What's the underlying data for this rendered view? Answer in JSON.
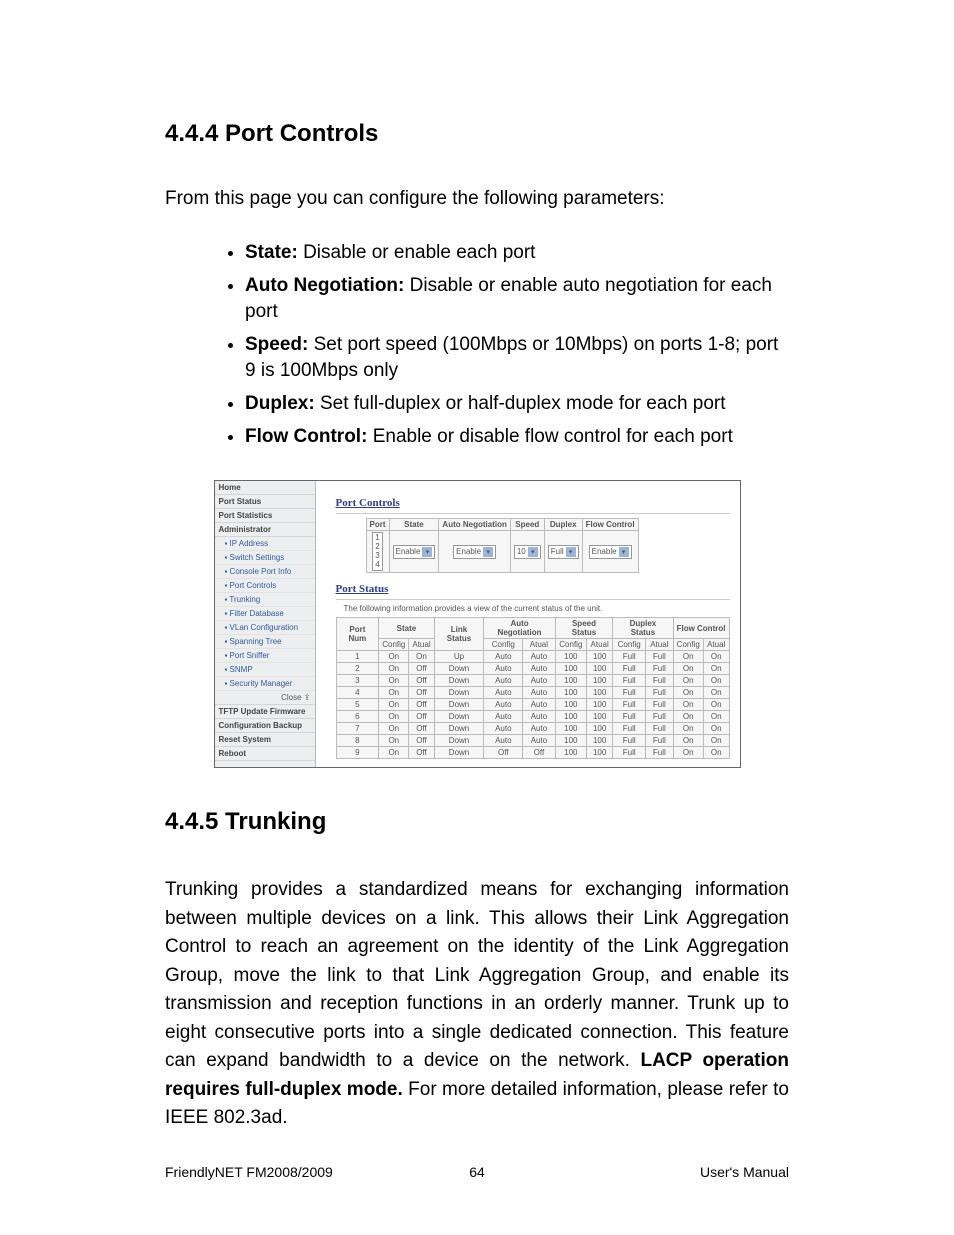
{
  "sections": {
    "s444": {
      "title": "4.4.4 Port Controls",
      "intro": "From this page you can configure the following parameters:",
      "bullets": [
        {
          "bold": "State:",
          "rest": " Disable or enable each port"
        },
        {
          "bold": "Auto Negotiation:",
          "rest": " Disable or enable auto negotiation for each port"
        },
        {
          "bold": "Speed:",
          "rest": " Set port speed (100Mbps or 10Mbps) on ports 1-8; port 9 is 100Mbps only"
        },
        {
          "bold": "Duplex:",
          "rest": " Set full-duplex or half-duplex mode for each port"
        },
        {
          "bold": "Flow Control:",
          "rest": " Enable or disable flow control for each port"
        }
      ]
    },
    "s445": {
      "title": "4.4.5 Trunking",
      "body_pre": "Trunking provides a standardized means for exchanging information between multiple devices on a link. This allows their Link Aggregation Control to reach an agreement on the identity of the Link Aggregation Group, move the link to that Link Aggregation Group, and enable its transmission and reception functions in an orderly manner. Trunk up to eight consecutive ports into a single dedicated connection. This feature can expand bandwidth to a device on the network. ",
      "body_bold": "LACP operation requires full-duplex mode.",
      "body_post": " For more detailed information, please refer to IEEE 802.3ad."
    }
  },
  "screenshot": {
    "nav": {
      "top": [
        "Home",
        "Port Status",
        "Port Statistics",
        "Administrator"
      ],
      "sub": [
        "IP Address",
        "Switch Settings",
        "Console Port Info",
        "Port Controls",
        "Trunking",
        "Filter Database",
        "VLan Configuration",
        "Spanning Tree",
        "Port Sniffer",
        "SNMP",
        "Security Manager"
      ],
      "close": "Close ⇪",
      "bottom": [
        "TFTP Update Firmware",
        "Configuration Backup",
        "Reset System",
        "Reboot"
      ]
    },
    "port_controls": {
      "title": "Port Controls",
      "headers": [
        "Port",
        "State",
        "Auto Negotiation",
        "Speed",
        "Duplex",
        "Flow Control"
      ],
      "port_options": [
        "1",
        "2",
        "3",
        "4"
      ],
      "state": "Enable",
      "autoneg": "Enable",
      "speed": "10",
      "duplex": "Full",
      "flow": "Enable"
    },
    "port_status": {
      "title": "Port Status",
      "note": "The following information provides a view of the current status of the unit.",
      "group_headers": [
        "Port Num",
        "State",
        "Link Status",
        "Auto Negotiation",
        "Speed Status",
        "Duplex Status",
        "Flow Control"
      ],
      "sub_headers": [
        "Config",
        "Atual",
        "Config",
        "Atual",
        "Config",
        "Atual",
        "Config",
        "Atual",
        "Config",
        "Atual"
      ],
      "rows": [
        [
          "1",
          "On",
          "On",
          "Up",
          "Auto",
          "Auto",
          "100",
          "100",
          "Full",
          "Full",
          "On",
          "On"
        ],
        [
          "2",
          "On",
          "Off",
          "Down",
          "Auto",
          "Auto",
          "100",
          "100",
          "Full",
          "Full",
          "On",
          "On"
        ],
        [
          "3",
          "On",
          "Off",
          "Down",
          "Auto",
          "Auto",
          "100",
          "100",
          "Full",
          "Full",
          "On",
          "On"
        ],
        [
          "4",
          "On",
          "Off",
          "Down",
          "Auto",
          "Auto",
          "100",
          "100",
          "Full",
          "Full",
          "On",
          "On"
        ],
        [
          "5",
          "On",
          "Off",
          "Down",
          "Auto",
          "Auto",
          "100",
          "100",
          "Full",
          "Full",
          "On",
          "On"
        ],
        [
          "6",
          "On",
          "Off",
          "Down",
          "Auto",
          "Auto",
          "100",
          "100",
          "Full",
          "Full",
          "On",
          "On"
        ],
        [
          "7",
          "On",
          "Off",
          "Down",
          "Auto",
          "Auto",
          "100",
          "100",
          "Full",
          "Full",
          "On",
          "On"
        ],
        [
          "8",
          "On",
          "Off",
          "Down",
          "Auto",
          "Auto",
          "100",
          "100",
          "Full",
          "Full",
          "On",
          "On"
        ],
        [
          "9",
          "On",
          "Off",
          "Down",
          "Off",
          "Off",
          "100",
          "100",
          "Full",
          "Full",
          "On",
          "On"
        ]
      ]
    }
  },
  "footer": {
    "left": "FriendlyNET FM2008/2009",
    "center": "64",
    "right": "User's Manual"
  }
}
